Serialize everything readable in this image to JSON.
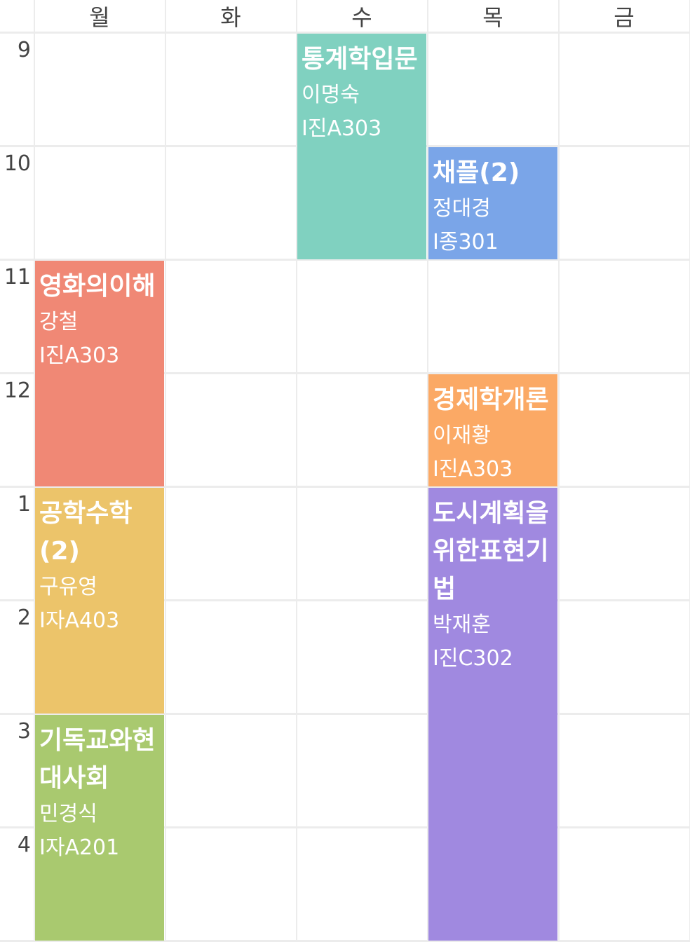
{
  "days": [
    "월",
    "화",
    "수",
    "목",
    "금"
  ],
  "hours": [
    "9",
    "10",
    "11",
    "12",
    "1",
    "2",
    "3",
    "4"
  ],
  "courses": [
    {
      "title": "통계학입문",
      "professor": "이명숙",
      "room": "I진A303",
      "day": 2,
      "start": 0,
      "end": 2,
      "color": "#80d1c0"
    },
    {
      "title": "채플(2)",
      "professor": "정대경",
      "room": "I종301",
      "day": 3,
      "start": 1,
      "end": 2,
      "color": "#7aa5e8"
    },
    {
      "title": "영화의이해",
      "professor": "강철",
      "room": "I진A303",
      "day": 0,
      "start": 2,
      "end": 4,
      "color": "#f08875"
    },
    {
      "title": "경제학개론",
      "professor": "이재황",
      "room": "I진A303",
      "day": 3,
      "start": 3,
      "end": 4,
      "color": "#fba965"
    },
    {
      "title": "공학수학(2)",
      "professor": "구유영",
      "room": "I자A403",
      "day": 0,
      "start": 4,
      "end": 6,
      "color": "#ecc46a"
    },
    {
      "title": "도시계획을위한표현기법",
      "professor": "박재훈",
      "room": "I진C302",
      "day": 3,
      "start": 4,
      "end": 8,
      "color": "#a089e0"
    },
    {
      "title": "기독교와현대사회",
      "professor": "민경식",
      "room": "I자A201",
      "day": 0,
      "start": 6,
      "end": 8,
      "color": "#a9c96f"
    }
  ]
}
